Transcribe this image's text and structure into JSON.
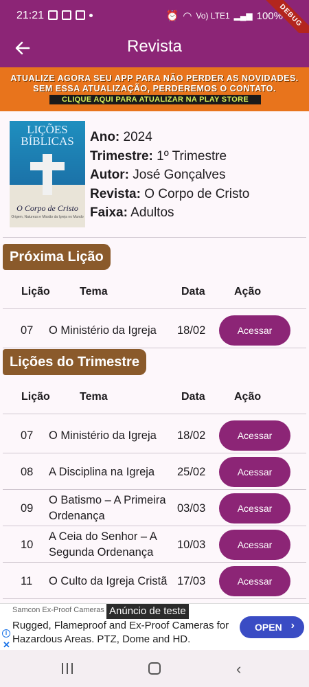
{
  "status_bar": {
    "time": "21:21",
    "battery": "100%",
    "network": "Vo) LTE1",
    "debug_label": "DEBUG"
  },
  "app_bar": {
    "title": "Revista",
    "back_icon": "arrow-left-icon"
  },
  "banner": {
    "line1": "ATUALIZE AGORA SEU APP PARA NÃO PERDER AS NOVIDADES.",
    "line2": "SEM ESSA ATUALIZAÇÃO, PERDEREMOS O CONTATO.",
    "cta": "CLIQUE AQUI PARA ATUALIZAR NA PLAY STORE",
    "bg_color": "#e8741c"
  },
  "magazine": {
    "cover_title": "LIÇÕES BÍBLICAS",
    "cover_subtitle": "O Corpo de Cristo",
    "cover_tagline": "Origem, Natureza e Missão da Igreja no Mundo",
    "fields": [
      {
        "label": "Ano:",
        "value": "2024"
      },
      {
        "label": "Trimestre:",
        "value": "1º Trimestre"
      },
      {
        "label": "Autor:",
        "value": "José Gonçalves"
      },
      {
        "label": "Revista:",
        "value": "O Corpo de Cristo"
      },
      {
        "label": "Faixa:",
        "value": "Adultos"
      }
    ]
  },
  "next_lesson": {
    "heading": "Próxima Lição",
    "columns": [
      "Lição",
      "Tema",
      "Data",
      "Ação"
    ],
    "row": {
      "num": "07",
      "tema": "O Ministério da Igreja",
      "data": "18/02",
      "action": "Acessar"
    }
  },
  "quarter_lessons": {
    "heading": "Lições do Trimestre",
    "columns": [
      "Lição",
      "Tema",
      "Data",
      "Ação"
    ],
    "rows": [
      {
        "num": "07",
        "tema": "O Ministério da Igreja",
        "data": "18/02",
        "action": "Acessar"
      },
      {
        "num": "08",
        "tema": "A Disciplina na Igreja",
        "data": "25/02",
        "action": "Acessar"
      },
      {
        "num": "09",
        "tema": "O Batismo – A Primeira Ordenança",
        "data": "03/03",
        "action": "Acessar"
      },
      {
        "num": "10",
        "tema": "A Ceia do Senhor – A Segunda Ordenança",
        "data": "10/03",
        "action": "Acessar"
      },
      {
        "num": "11",
        "tema": "O Culto da Igreja Cristã",
        "data": "17/03",
        "action": "Acessar"
      }
    ]
  },
  "ad": {
    "advertiser": "Samcon Ex-Proof Cameras",
    "test_label": "Anúncio de teste",
    "text": "Rugged, Flameproof and Ex-Proof Cameras for Hazardous Areas. PTZ, Dome and HD.",
    "button": "OPEN",
    "button_color": "#3a4cc4"
  },
  "colors": {
    "primary": "#8c2576",
    "section_label": "#8a5a2b",
    "background": "#fdf7fb"
  }
}
